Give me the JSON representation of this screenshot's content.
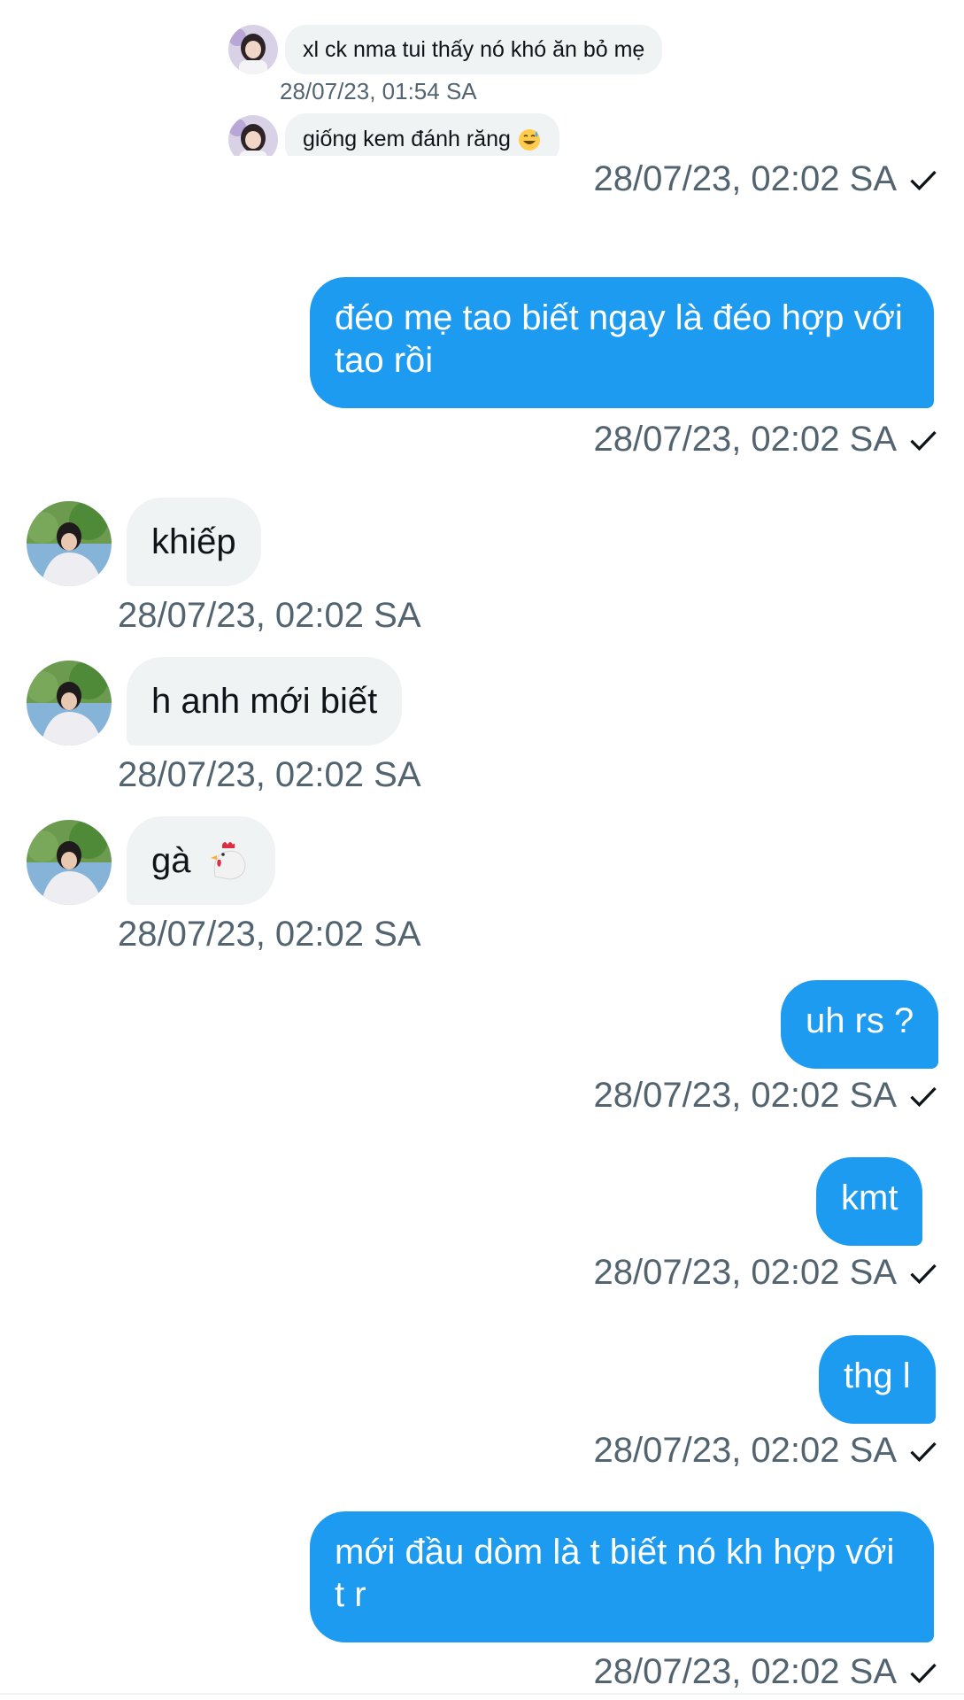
{
  "quoted": {
    "messages": [
      {
        "text": "xl ck nma tui thấy nó khó ăn bỏ mẹ",
        "timestamp": "28/07/23, 01:54 SA"
      },
      {
        "text": "giống kem đánh răng",
        "emoji": "grinning-sweat-emoji"
      }
    ]
  },
  "messages": [
    {
      "direction": "out",
      "timestamp": "28/07/23, 02:02 SA"
    },
    {
      "direction": "out",
      "text": "đéo mẹ tao biết ngay là đéo hợp với tao rồi",
      "timestamp": "28/07/23, 02:02 SA"
    },
    {
      "direction": "in",
      "text": "khiếp",
      "timestamp": "28/07/23, 02:02 SA"
    },
    {
      "direction": "in",
      "text": "h anh mới biết",
      "timestamp": "28/07/23, 02:02 SA"
    },
    {
      "direction": "in",
      "text": "gà",
      "emoji": "rooster-emoji",
      "timestamp": "28/07/23, 02:02 SA"
    },
    {
      "direction": "out",
      "text": "uh rs ?",
      "timestamp": "28/07/23, 02:02 SA"
    },
    {
      "direction": "out",
      "text": "kmt",
      "timestamp": "28/07/23, 02:02 SA"
    },
    {
      "direction": "out",
      "text": "thg l",
      "timestamp": "28/07/23, 02:02 SA"
    },
    {
      "direction": "out",
      "text": "mới đầu dòm là t biết nó kh hợp với t r",
      "timestamp": "28/07/23, 02:02 SA"
    }
  ],
  "colors": {
    "outgoing_bubble": "#1d9bf0",
    "incoming_bubble": "#eff3f4",
    "timestamp_text": "#536471",
    "text": "#0f1419"
  },
  "icons": {
    "sent": "check-icon"
  }
}
